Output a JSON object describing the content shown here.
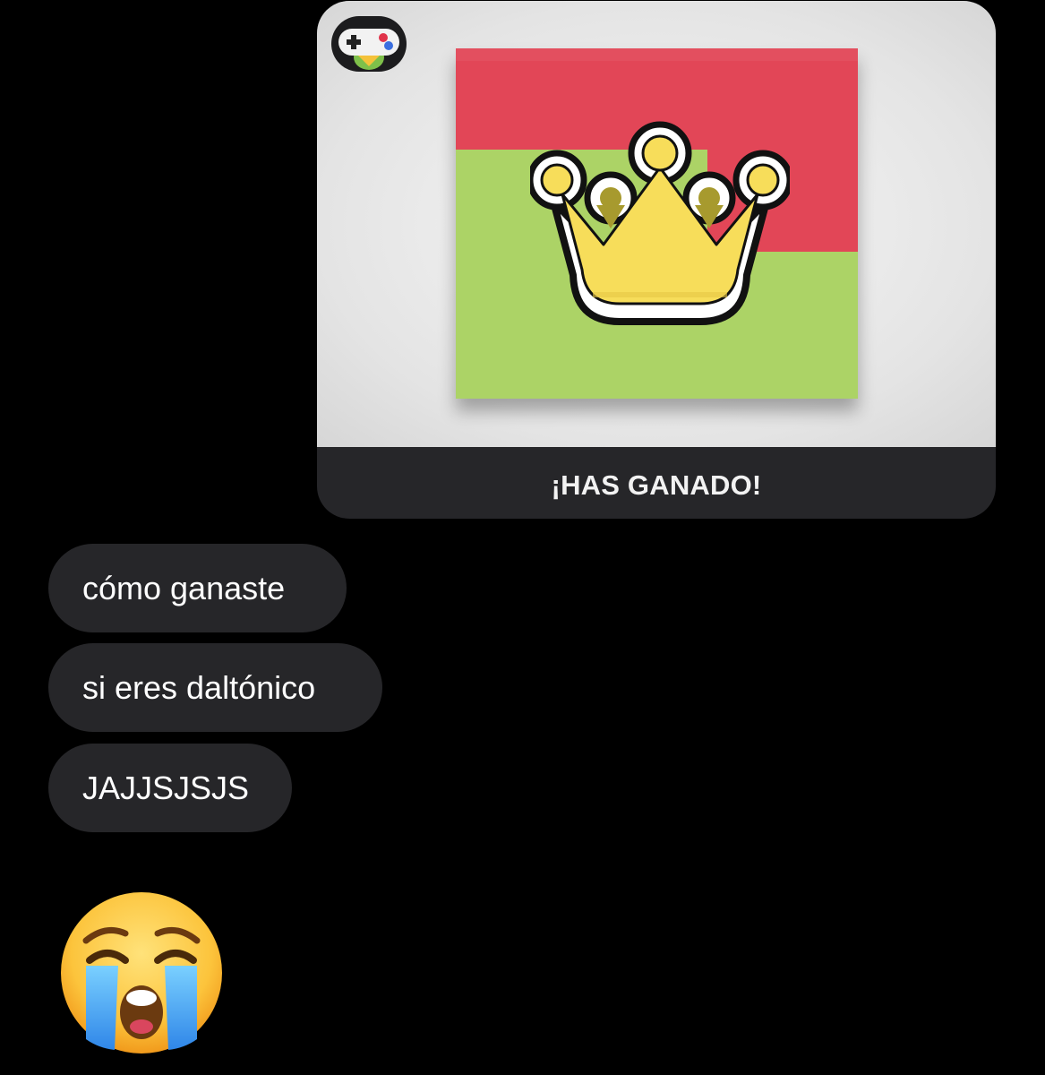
{
  "game_message": {
    "caption": "¡HAS GANADO!",
    "app_icon": "gamepigeon-app-icon",
    "image": {
      "icon": "crown-icon",
      "colors": {
        "red_area": "#e24657",
        "green_area": "#acd366",
        "crown_fill": "#f7dd5a"
      }
    }
  },
  "messages": [
    {
      "text": "cómo ganaste"
    },
    {
      "text": "si eres daltónico"
    },
    {
      "text": "JAJJSJSJS"
    }
  ],
  "last_message": {
    "emoji": "loudly-crying-face-emoji"
  },
  "colors": {
    "background": "#000000",
    "bubble": "#262629",
    "bubble_text": "#ffffff"
  }
}
